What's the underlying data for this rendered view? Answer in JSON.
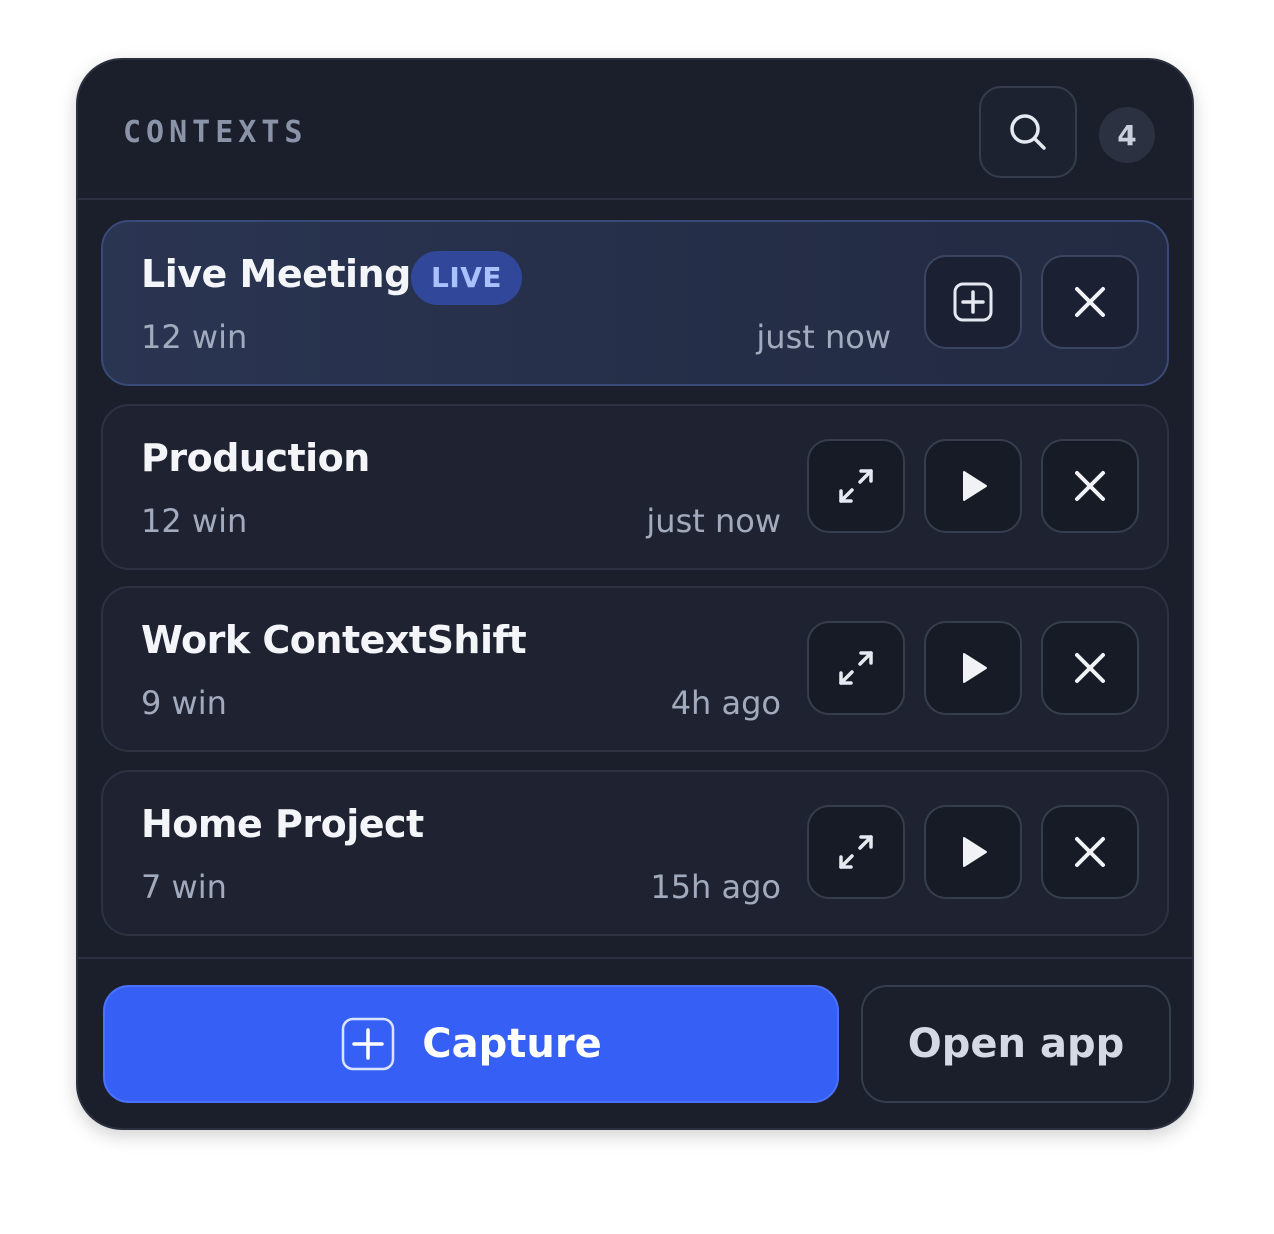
{
  "header": {
    "title": "CONTEXTS",
    "search_icon": "search-icon",
    "count": "4"
  },
  "contexts": [
    {
      "name": "Live Meeting",
      "badge": "LIVE",
      "windows": "12 win",
      "time": "just now",
      "actions": [
        "add-icon",
        "close-icon"
      ]
    },
    {
      "name": "Production",
      "windows": "12 win",
      "time": "just now",
      "actions": [
        "expand-icon",
        "play-icon",
        "close-icon"
      ]
    },
    {
      "name": "Work ContextShift",
      "windows": "9 win",
      "time": "4h ago",
      "actions": [
        "expand-icon",
        "play-icon",
        "close-icon"
      ]
    },
    {
      "name": "Home Project",
      "windows": "7 win",
      "time": "15h ago",
      "actions": [
        "expand-icon",
        "play-icon",
        "close-icon"
      ]
    }
  ],
  "footer": {
    "capture_label": "Capture",
    "capture_icon": "plus-square-icon",
    "open_app_label": "Open app"
  },
  "colors": {
    "panel_bg": "#1b1f2b",
    "accent": "#3660f5",
    "live_badge_bg": "#31489a",
    "live_badge_text": "#a9c1ff"
  }
}
